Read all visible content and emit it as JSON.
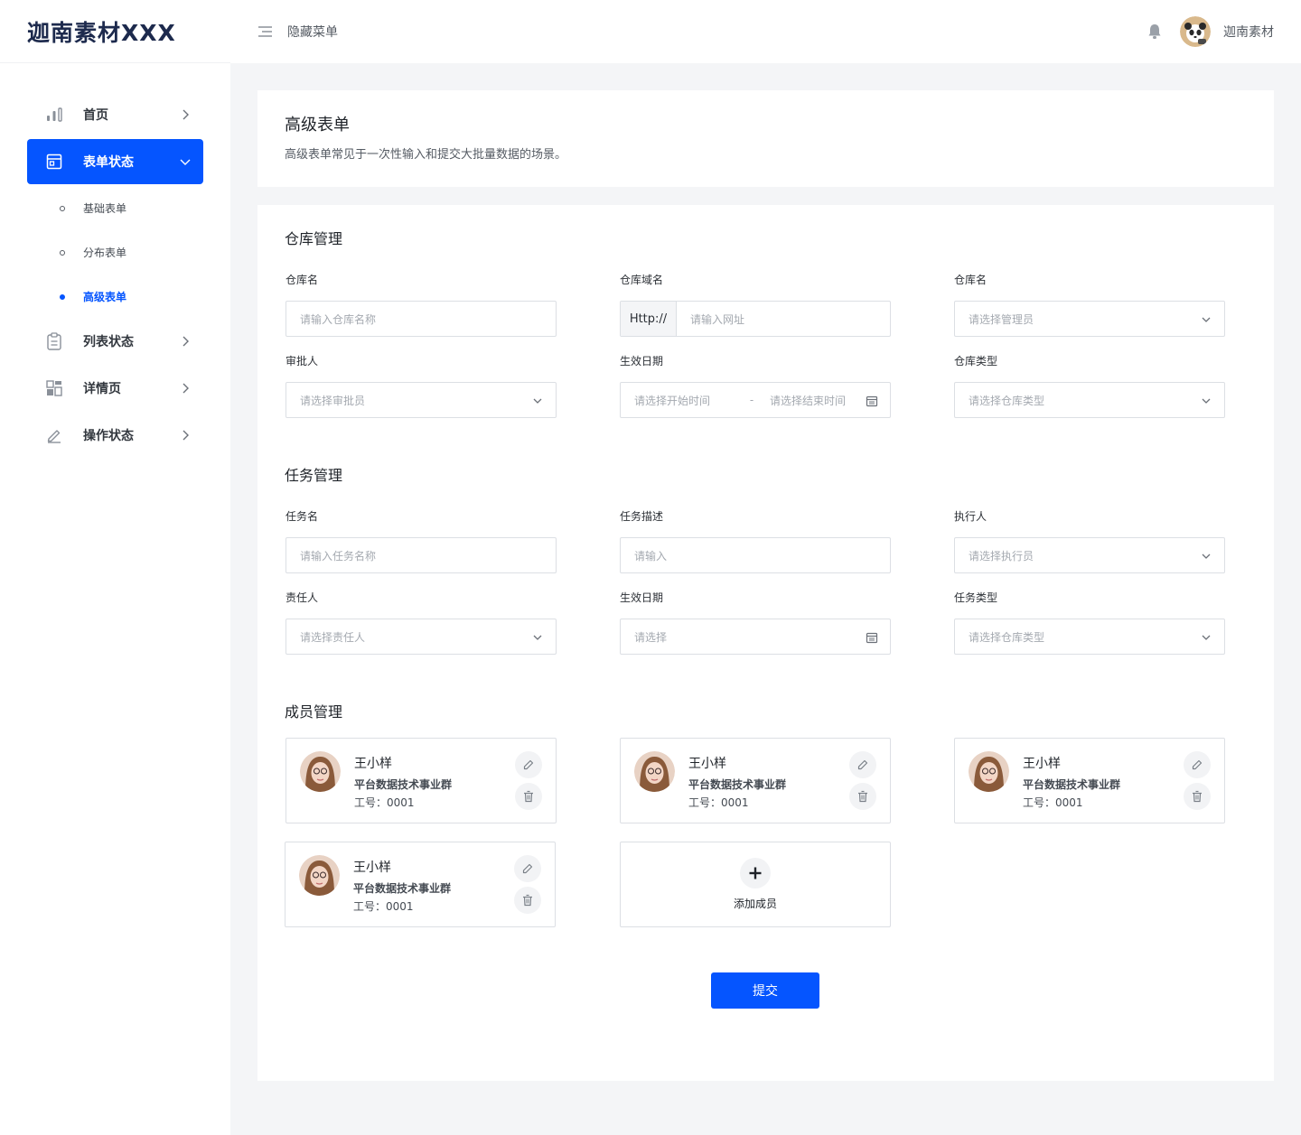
{
  "brand": {
    "logo_text": "迦南素材XXX"
  },
  "header": {
    "hide_menu_label": "隐藏菜单",
    "username": "迦南素材"
  },
  "sidebar": {
    "items": [
      {
        "label": "首页",
        "icon": "bar-chart-icon"
      },
      {
        "label": "表单状态",
        "icon": "form-window-icon",
        "active": true,
        "children": [
          {
            "label": "基础表单"
          },
          {
            "label": "分布表单"
          },
          {
            "label": "高级表单",
            "active": true
          }
        ]
      },
      {
        "label": "列表状态",
        "icon": "clipboard-icon"
      },
      {
        "label": "详情页",
        "icon": "grid-icon"
      },
      {
        "label": "操作状态",
        "icon": "pen-icon"
      }
    ]
  },
  "page": {
    "title": "高级表单",
    "description": "高级表单常见于一次性输入和提交大批量数据的场景。"
  },
  "warehouse": {
    "title": "仓库管理",
    "fields": {
      "name": {
        "label": "仓库名",
        "placeholder": "请输入仓库名称"
      },
      "domain": {
        "label": "仓库域名",
        "prefix": "Http://",
        "placeholder": "请输入网址"
      },
      "manager": {
        "label": "仓库名",
        "placeholder": "请选择管理员"
      },
      "approver": {
        "label": "审批人",
        "placeholder": "请选择审批员"
      },
      "effective_date": {
        "label": "生效日期",
        "start_placeholder": "请选择开始时间",
        "separator": "-",
        "end_placeholder": "请选择结束时间"
      },
      "type": {
        "label": "仓库类型",
        "placeholder": "请选择仓库类型"
      }
    }
  },
  "task": {
    "title": "任务管理",
    "fields": {
      "name": {
        "label": "任务名",
        "placeholder": "请输入任务名称"
      },
      "desc": {
        "label": "任务描述",
        "placeholder": "请输入"
      },
      "executor": {
        "label": "执行人",
        "placeholder": "请选择执行员"
      },
      "owner": {
        "label": "责任人",
        "placeholder": "请选择责任人"
      },
      "effective_date": {
        "label": "生效日期",
        "placeholder": "请选择"
      },
      "type": {
        "label": "任务类型",
        "placeholder": "请选择仓库类型"
      }
    }
  },
  "members": {
    "title": "成员管理",
    "list": [
      {
        "name": "王小样",
        "dept": "平台数据技术事业群",
        "employee_no": "工号：0001"
      },
      {
        "name": "王小样",
        "dept": "平台数据技术事业群",
        "employee_no": "工号：0001"
      },
      {
        "name": "王小样",
        "dept": "平台数据技术事业群",
        "employee_no": "工号：0001"
      },
      {
        "name": "王小样",
        "dept": "平台数据技术事业群",
        "employee_no": "工号：0001"
      }
    ],
    "add_label": "添加成员"
  },
  "submit_label": "提交",
  "colors": {
    "primary": "#0555ff",
    "border": "#dcdfe4",
    "page_bg": "#f4f5f7"
  }
}
